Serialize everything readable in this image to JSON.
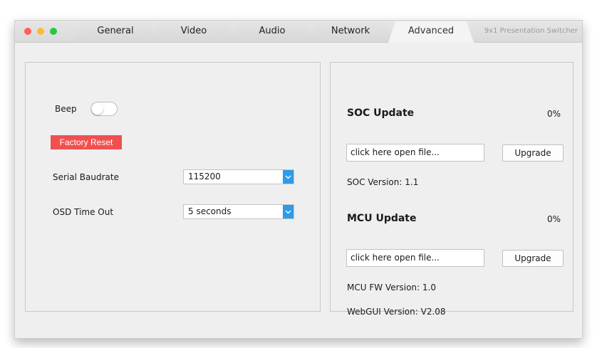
{
  "window": {
    "app_title": "9x1 Presentation Switcher",
    "traffic_colors": {
      "close": "#ff5f57",
      "minimize": "#febc2e",
      "zoom": "#28c840"
    }
  },
  "tabs": [
    {
      "label": "General",
      "active": false
    },
    {
      "label": "Video",
      "active": false
    },
    {
      "label": "Audio",
      "active": false
    },
    {
      "label": "Network",
      "active": false
    },
    {
      "label": "Advanced",
      "active": true
    }
  ],
  "left": {
    "beep_label": "Beep",
    "beep_on": false,
    "factory_reset_label": "Factory Reset",
    "factory_reset_color": "#f0504f",
    "serial_baudrate_label": "Serial Baudrate",
    "serial_baudrate_value": "115200",
    "osd_timeout_label": "OSD Time Out",
    "osd_timeout_value": "5 seconds",
    "select_arrow_color": "#2f9be8"
  },
  "right": {
    "soc": {
      "title": "SOC Update",
      "progress": "0%",
      "file_placeholder": "click here open file...",
      "upgrade_label": "Upgrade",
      "version_label": "SOC Version:",
      "version_value": "1.1"
    },
    "mcu": {
      "title": "MCU Update",
      "progress": "0%",
      "file_placeholder": "click here open file...",
      "upgrade_label": "Upgrade",
      "fw_version_label": "MCU FW Version:",
      "fw_version_value": "1.0",
      "webgui_version_label": "WebGUI Version:",
      "webgui_version_value": "V2.08"
    }
  }
}
